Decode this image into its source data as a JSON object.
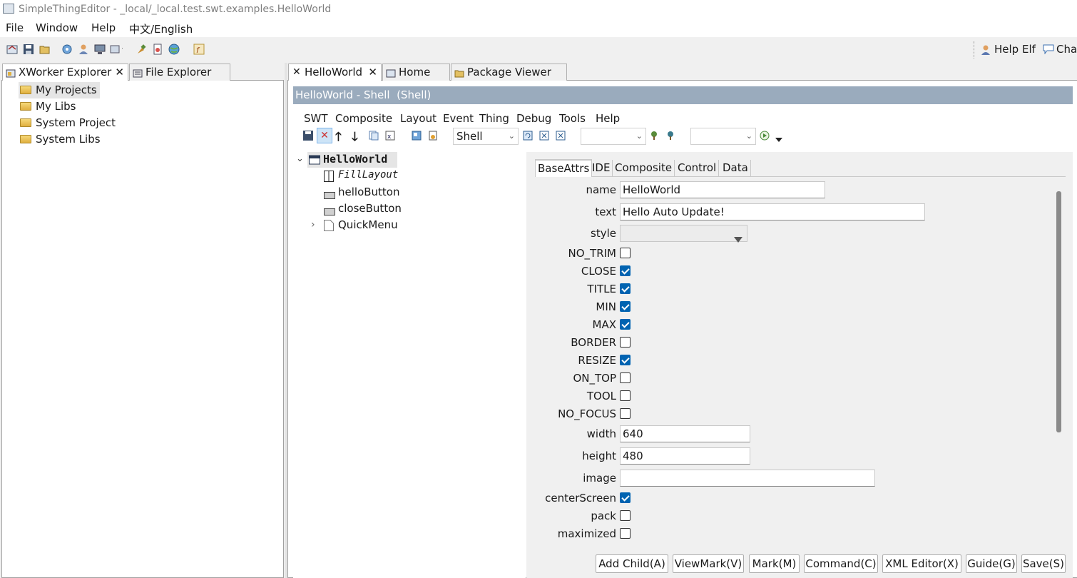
{
  "window": {
    "title": "SimpleThingEditor - _local/_local.test.swt.examples.HelloWorld"
  },
  "menu": [
    "File",
    "Window",
    "Help",
    "中文/English"
  ],
  "toolbar_right": {
    "help_elf": "Help Elf",
    "chat": "Chat"
  },
  "left_tabs": [
    {
      "label": "XWorker Explorer"
    },
    {
      "label": "File Explorer"
    }
  ],
  "left_tree": [
    "My Projects",
    "My Libs",
    "System Project",
    "System Libs"
  ],
  "editor_tabs": [
    {
      "label": "HelloWorld"
    },
    {
      "label": "Home"
    },
    {
      "label": "Package Viewer"
    }
  ],
  "editor_title": "HelloWorld - Shell  (Shell)",
  "editor_menu": [
    "SWT",
    "Composite",
    "Layout",
    "Event",
    "Thing",
    "Debug",
    "Tools",
    "Help"
  ],
  "editor_toolbar": {
    "type_select": "Shell",
    "select2": "",
    "select3": ""
  },
  "thing_tree": {
    "root": "HelloWorld",
    "children": [
      "FillLayout",
      "helloButton",
      "closeButton",
      "QuickMenu"
    ]
  },
  "attr_tabs": [
    "BaseAttrs",
    "IDE",
    "Composite",
    "Control",
    "Data"
  ],
  "attrs": {
    "name": {
      "label": "name",
      "value": "HelloWorld"
    },
    "text": {
      "label": "text",
      "value": "Hello Auto Update!"
    },
    "style": {
      "label": "style",
      "value": ""
    },
    "checks1": [
      {
        "label": "NO_TRIM",
        "checked": false
      },
      {
        "label": "CLOSE",
        "checked": true
      },
      {
        "label": "TITLE",
        "checked": true
      },
      {
        "label": "MIN",
        "checked": true
      },
      {
        "label": "MAX",
        "checked": true
      },
      {
        "label": "BORDER",
        "checked": false
      },
      {
        "label": "RESIZE",
        "checked": true
      },
      {
        "label": "ON_TOP",
        "checked": false
      },
      {
        "label": "TOOL",
        "checked": false
      },
      {
        "label": "NO_FOCUS",
        "checked": false
      }
    ],
    "width": {
      "label": "width",
      "value": "640"
    },
    "height": {
      "label": "height",
      "value": "480"
    },
    "image": {
      "label": "image",
      "value": ""
    },
    "checks2": [
      {
        "label": "centerScreen",
        "checked": true
      },
      {
        "label": "pack",
        "checked": false
      },
      {
        "label": "maximized",
        "checked": false
      }
    ]
  },
  "buttons": {
    "add_child": "Add Child(A)",
    "view_mark": "ViewMark(V)",
    "mark": "Mark(M)",
    "command": "Command(C)",
    "xml_editor": "XML Editor(X)",
    "guide": "Guide(G)",
    "save": "Save(S)"
  },
  "colors": {
    "title_band": "#9aabbd",
    "check_on": "#0063b1",
    "selection": "#e5e5e5"
  }
}
